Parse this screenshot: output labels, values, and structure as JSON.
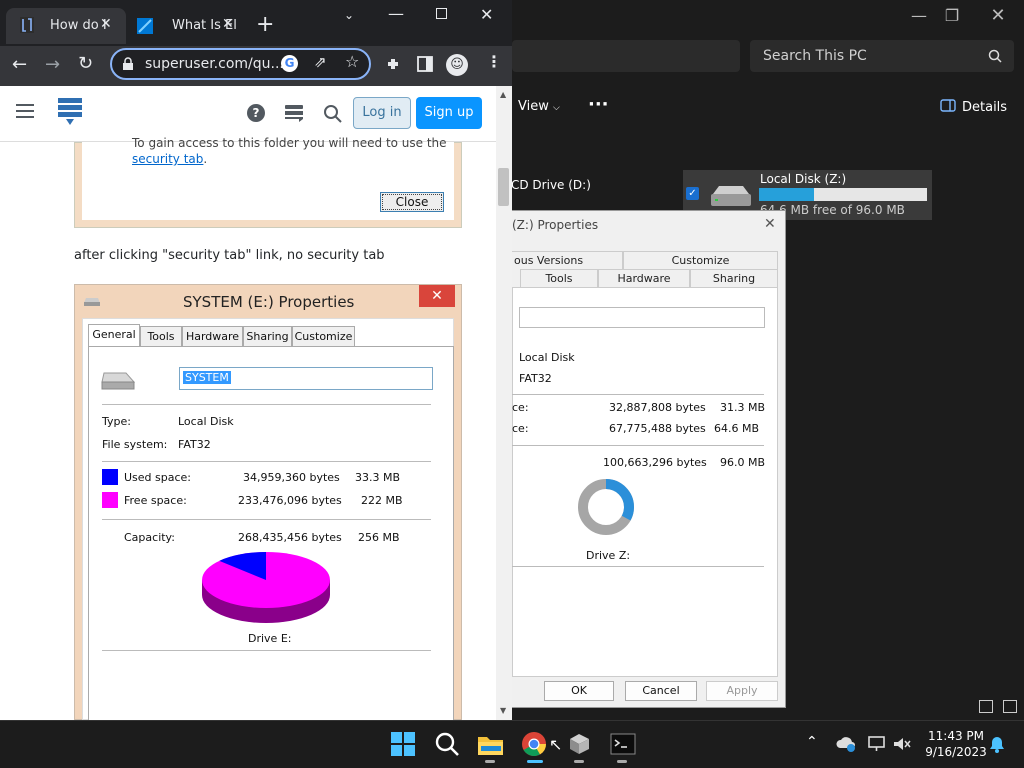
{
  "chrome": {
    "tabs": [
      {
        "label": "How do I",
        "active": true
      },
      {
        "label": "What Is El",
        "active": false
      }
    ],
    "new_tab": "+",
    "omnibox": "superuser.com/qu...",
    "site": {
      "login": "Log in",
      "signup": "Sign up"
    }
  },
  "article": {
    "snippet1_text": "To gain access to this folder you will need to use the",
    "snippet1_link": "security tab",
    "snippet1_period": ".",
    "close_btn": "Close",
    "paragraph": "after clicking \"security tab\" link, no security tab",
    "dialog": {
      "title": "SYSTEM (E:) Properties",
      "tabs": [
        "General",
        "Tools",
        "Hardware",
        "Sharing",
        "Customize"
      ],
      "name_value": "SYSTEM",
      "type_label": "Type:",
      "type_value": "Local Disk",
      "fs_label": "File system:",
      "fs_value": "FAT32",
      "used_label": "Used space:",
      "used_bytes": "34,959,360 bytes",
      "used_h": "33.3 MB",
      "free_label": "Free space:",
      "free_bytes": "233,476,096 bytes",
      "free_h": "222 MB",
      "cap_label": "Capacity:",
      "cap_bytes": "268,435,456 bytes",
      "cap_h": "256 MB",
      "drive_label": "Drive E:",
      "used_color": "#0000ff",
      "free_color": "#ff00ff",
      "used_fraction": 0.13
    }
  },
  "explorer": {
    "search_placeholder": "Search This PC",
    "view_label": "View",
    "more_label": "···",
    "details_label": "Details",
    "cd_drive": "CD Drive (D:)",
    "drive_z": {
      "name": "Local Disk (Z:)",
      "free": "64.6 MB free of 96.0 MB",
      "used_fraction": 0.33
    }
  },
  "properties_z": {
    "title": "(Z:) Properties",
    "tabs_row1": [
      "ous Versions",
      "Customize"
    ],
    "tabs_row2": [
      "Tools",
      "Hardware",
      "Sharing"
    ],
    "type_value": "Local Disk",
    "fs_value": "FAT32",
    "used_label": "ce:",
    "used_bytes": "32,887,808 bytes",
    "used_h": "31.3 MB",
    "free_label": "ce:",
    "free_bytes": "67,775,488 bytes",
    "free_h": "64.6 MB",
    "cap_bytes": "100,663,296 bytes",
    "cap_h": "96.0 MB",
    "drive_label": "Drive Z:",
    "ok": "OK",
    "cancel": "Cancel",
    "apply": "Apply",
    "used_fraction": 0.33
  },
  "taskbar": {
    "time": "11:43 PM",
    "date": "9/16/2023"
  },
  "colors": {
    "accent": "#0a95ff",
    "chrome_dark": "#202124",
    "explorer_bg": "#1c1c1c"
  }
}
